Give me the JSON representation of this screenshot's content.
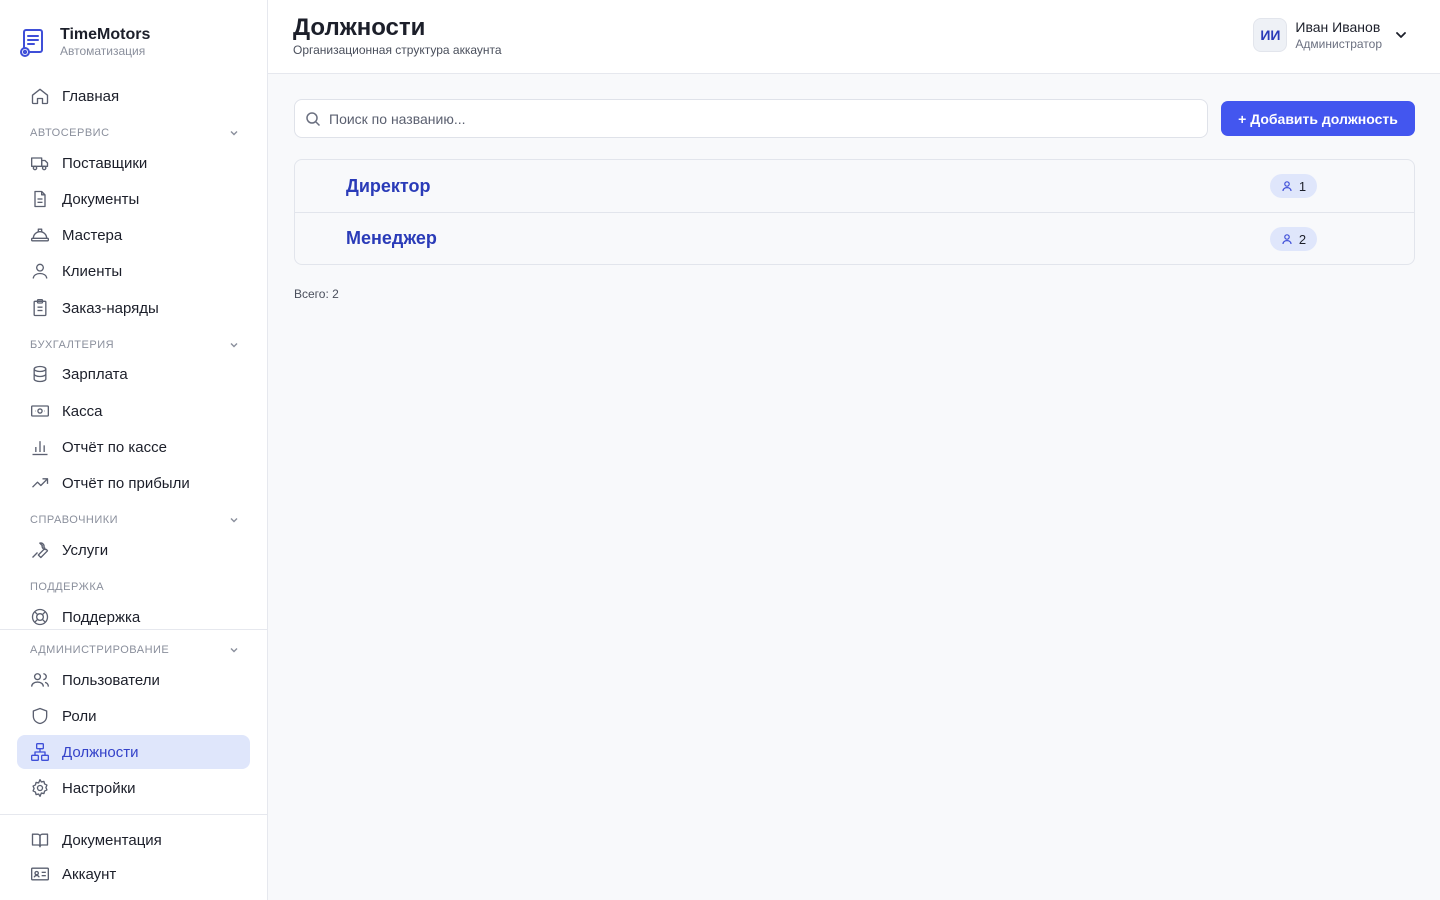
{
  "brand": {
    "title": "TimeMotors",
    "subtitle": "Автоматизация"
  },
  "sidebar": {
    "home": "Главная",
    "sections": {
      "autoservice": "Автосервис",
      "accounting": "Бухгалтерия",
      "references": "Справочники",
      "support": "Поддержка",
      "admin": "Администрирование"
    },
    "items": {
      "suppliers": "Поставщики",
      "documents": "Документы",
      "masters": "Мастера",
      "clients": "Клиенты",
      "orders": "Заказ-наряды",
      "salary": "Зарплата",
      "cash": "Касса",
      "cash_report": "Отчёт по кассе",
      "profit_report": "Отчёт по прибыли",
      "services": "Услуги",
      "support": "Поддержка",
      "users": "Пользователи",
      "roles": "Роли",
      "positions": "Должности",
      "settings": "Настройки",
      "documentation": "Документация",
      "account": "Аккаунт"
    },
    "active": "positions"
  },
  "header": {
    "title": "Должности",
    "subtitle": "Организационная структура аккаунта",
    "user": {
      "initials": "ИИ",
      "name": "Иван Иванов",
      "role": "Администратор"
    }
  },
  "main": {
    "search_placeholder": "Поиск по названию...",
    "add_button": "+ Добавить должность",
    "positions": [
      {
        "name": "Директор",
        "count": "1"
      },
      {
        "name": "Менеджер",
        "count": "2"
      }
    ],
    "total": "Всего: 2"
  },
  "colors": {
    "accent": "#4356ef",
    "active_bg": "#dfe6fb",
    "link": "#2a3bb8"
  }
}
